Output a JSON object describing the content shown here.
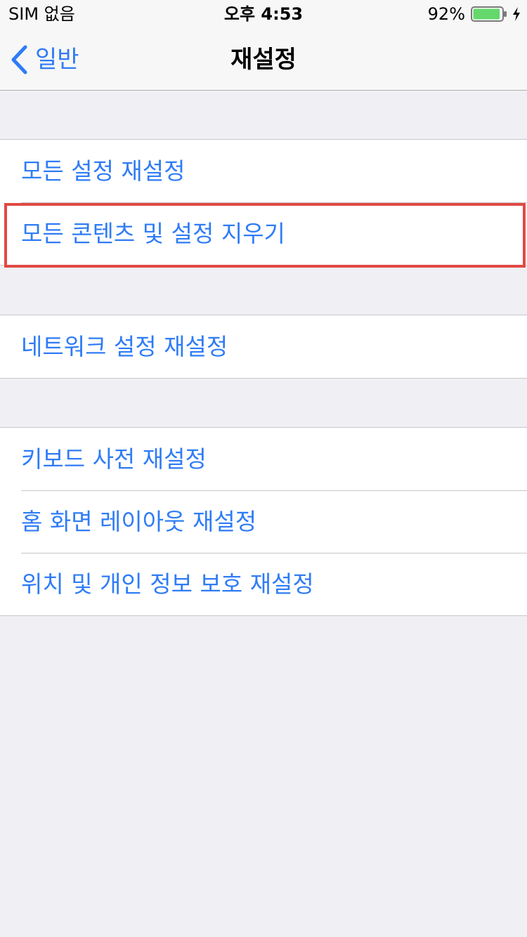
{
  "status_bar": {
    "carrier": "SIM 없음",
    "time": "오후 4:53",
    "battery_percent": "92%",
    "battery_level": 0.92,
    "battery_color": "#65d86b",
    "charging": true,
    "icons": [
      "battery-icon",
      "charging-bolt-icon"
    ]
  },
  "nav_bar": {
    "back_label": "일반",
    "back_icon": "chevron-left-icon",
    "title": "재설정"
  },
  "groups": [
    {
      "items": [
        {
          "label": "모든 설정 재설정"
        },
        {
          "label": "모든 콘텐츠 및 설정 지우기",
          "highlighted": true
        }
      ]
    },
    {
      "items": [
        {
          "label": "네트워크 설정 재설정"
        }
      ]
    },
    {
      "items": [
        {
          "label": "키보드 사전 재설정"
        },
        {
          "label": "홈 화면 레이아웃 재설정"
        },
        {
          "label": "위치 및 개인 정보 보호 재설정"
        }
      ]
    }
  ],
  "colors": {
    "accent": "#2f7cf6",
    "background": "#efeff4",
    "highlight": "#e04a44"
  }
}
